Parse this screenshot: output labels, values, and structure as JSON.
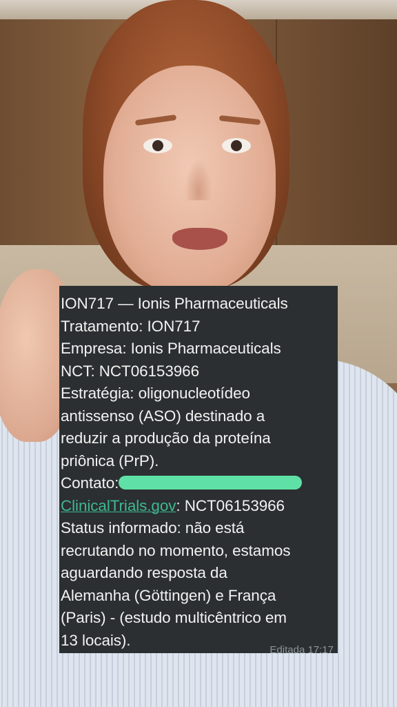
{
  "message": {
    "title_line": "ION717 — Ionis Pharmaceuticals",
    "treatment": "Tratamento: ION717",
    "company": "Empresa: Ionis Pharmaceuticals",
    "nct": "NCT: NCT06153966",
    "strategy_lines": [
      "Estratégia: oligonucleotídeo",
      "antissenso (ASO) destinado a",
      "reduzir a produção da proteína",
      "priônica (PrP)."
    ],
    "contact_label": "Contato:",
    "link_text": "ClinicalTrials.gov",
    "link_suffix": ": NCT06153966",
    "status_lines": [
      "Status informado: não está",
      "recrutando no momento, estamos",
      "aguardando resposta da",
      "Alemanha (Göttingen) e França",
      "(Paris) - (estudo multicêntrico em",
      "13 locais)."
    ],
    "edited_label": "Editada",
    "time": "17:17"
  },
  "colors": {
    "bubble": "#2b2f31",
    "text": "#f2f2f2",
    "link": "#3fb88f",
    "redaction": "#5fe0a6"
  }
}
